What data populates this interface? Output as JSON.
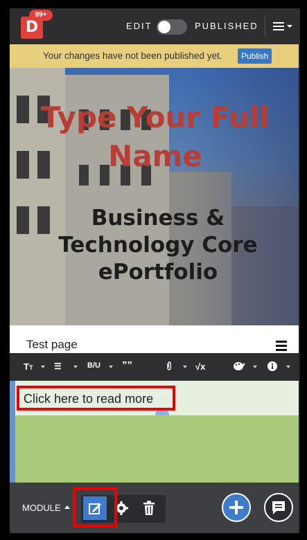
{
  "topbar": {
    "logo_letter": "D",
    "notification_count": "99+",
    "edit_label": "EDIT",
    "published_label": "PUBLISHED",
    "toggle_state": "off"
  },
  "notice": {
    "message": "Your changes have not been published yet.",
    "publish_label": "Publish"
  },
  "hero": {
    "name": "Type Your Full Name",
    "subtitle": "Business & Technology Core ePortfolio"
  },
  "page": {
    "title": "Test page"
  },
  "toolbar": {
    "items": [
      "text-size-icon",
      "list-icon",
      "bold-underline-icon",
      "quote-icon",
      "attachment-icon",
      "math-icon",
      "paint-icon",
      "info-icon"
    ],
    "bold_underline_label": "B/U",
    "quote_label": "””",
    "math_label": "√x"
  },
  "content": {
    "read_more": "Click here to read more"
  },
  "bottombar": {
    "module_label": "MODULE"
  },
  "colors": {
    "accent": "#3f7acd",
    "brand_red": "#e2403b",
    "notice_bg": "#e7cf7d",
    "hero_name": "#b63e36",
    "highlight": "#ee0000"
  }
}
